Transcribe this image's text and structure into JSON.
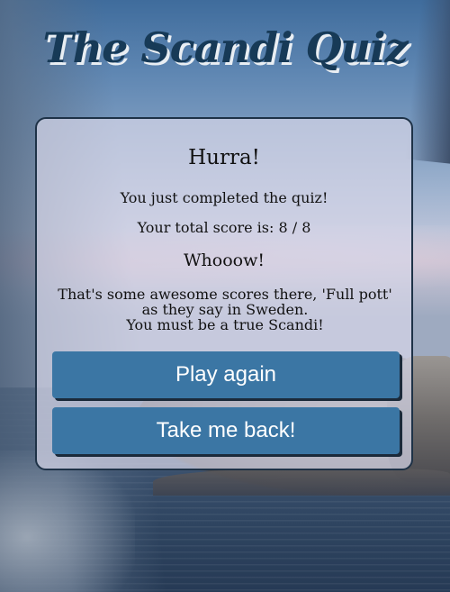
{
  "page": {
    "title": "The Scandi Quiz"
  },
  "result_card": {
    "heading": "Hurra!",
    "completed_text": "You just completed the quiz!",
    "score_label": "Your total score is:",
    "score_value": "8 / 8",
    "reaction": "Whooow!",
    "message_lines": [
      "That's some awesome scores there, 'Full pott'",
      "as they say in Sweden.",
      "You must be a true Scandi!"
    ]
  },
  "buttons": {
    "play_again": "Play again",
    "take_me_back": "Take me back!"
  },
  "colors": {
    "title": "#173a57",
    "button": "#3b76a4",
    "card_border": "#1e3247"
  }
}
